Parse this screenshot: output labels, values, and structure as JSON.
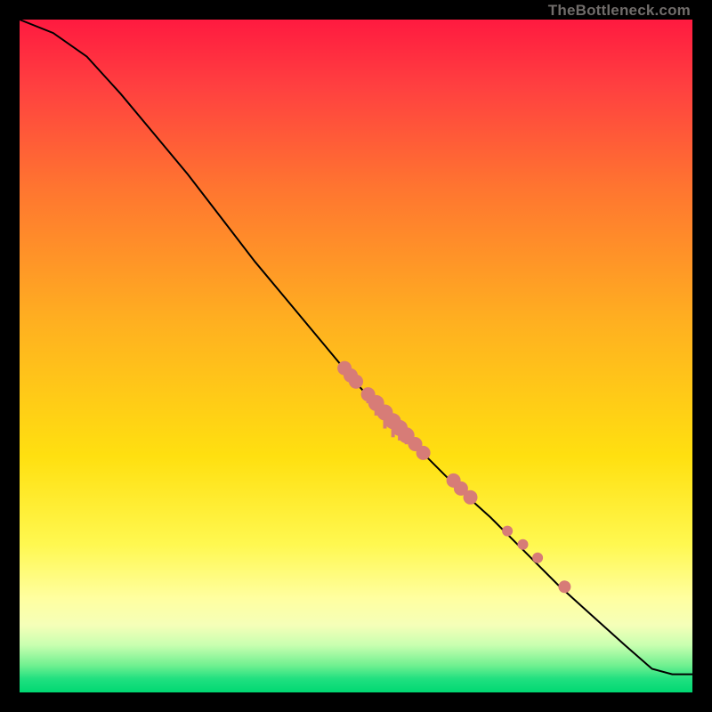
{
  "attribution": "TheBottleneck.com",
  "chart_data": {
    "type": "line",
    "title": "",
    "xlabel": "",
    "ylabel": "",
    "xlim": [
      0,
      100
    ],
    "ylim": [
      0,
      100
    ],
    "series": [
      {
        "name": "curve",
        "x": [
          0,
          5,
          10,
          15,
          20,
          25,
          30,
          35,
          40,
          45,
          50,
          55,
          60,
          65,
          70,
          75,
          80,
          85,
          90,
          94,
          97,
          100
        ],
        "y": [
          100,
          98,
          94.5,
          89,
          83,
          77,
          70.5,
          64,
          58,
          52,
          46,
          40.5,
          35.5,
          30.5,
          26,
          21,
          16,
          11.5,
          7,
          3.5,
          2.7,
          2.7
        ]
      }
    ],
    "points": {
      "name": "cluster",
      "data": [
        {
          "x": 48.3,
          "y": 48.2,
          "r": 8
        },
        {
          "x": 49.2,
          "y": 47.1,
          "r": 8
        },
        {
          "x": 50.0,
          "y": 46.2,
          "r": 8
        },
        {
          "x": 51.8,
          "y": 44.3,
          "r": 8,
          "tail": 10
        },
        {
          "x": 53.0,
          "y": 43.0,
          "r": 9,
          "tail": 14
        },
        {
          "x": 54.3,
          "y": 41.6,
          "r": 9,
          "tail": 18
        },
        {
          "x": 55.5,
          "y": 40.3,
          "r": 9,
          "tail": 18
        },
        {
          "x": 56.5,
          "y": 39.3,
          "r": 9,
          "tail": 14
        },
        {
          "x": 57.5,
          "y": 38.2,
          "r": 9,
          "tail": 10
        },
        {
          "x": 58.8,
          "y": 36.9,
          "r": 8
        },
        {
          "x": 60.0,
          "y": 35.6,
          "r": 8
        },
        {
          "x": 64.5,
          "y": 31.5,
          "r": 8
        },
        {
          "x": 65.6,
          "y": 30.3,
          "r": 8
        },
        {
          "x": 67.0,
          "y": 29.0,
          "r": 8
        },
        {
          "x": 72.5,
          "y": 24.0,
          "r": 6
        },
        {
          "x": 74.8,
          "y": 22.0,
          "r": 6
        },
        {
          "x": 77.0,
          "y": 20.0,
          "r": 6
        },
        {
          "x": 81.0,
          "y": 15.7,
          "r": 7
        }
      ]
    },
    "background_gradient": [
      "#ff1a40",
      "#ffe010",
      "#fff850",
      "#00d872"
    ]
  }
}
